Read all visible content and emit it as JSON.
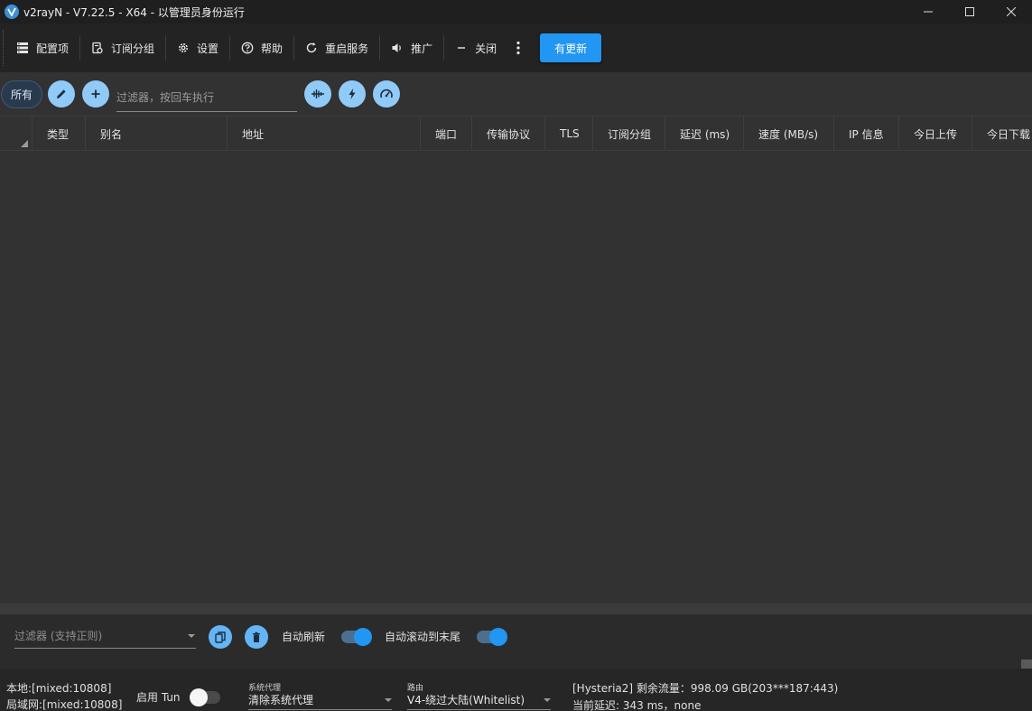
{
  "window": {
    "title": "v2rayN - V7.22.5 - X64 - 以管理员身份运行"
  },
  "toolbar": {
    "items": [
      {
        "label": "配置项",
        "icon": "server-icon"
      },
      {
        "label": "订阅分组",
        "icon": "subscription-icon"
      },
      {
        "label": "设置",
        "icon": "gear-icon"
      },
      {
        "label": "帮助",
        "icon": "help-icon"
      },
      {
        "label": "重启服务",
        "icon": "restart-icon"
      },
      {
        "label": "推广",
        "icon": "speaker-icon"
      },
      {
        "label": "关闭",
        "icon": "minus-icon"
      }
    ],
    "update_label": "有更新"
  },
  "filter": {
    "all_label": "所有",
    "placeholder": "过滤器，按回车执行"
  },
  "table": {
    "columns": [
      "类型",
      "别名",
      "地址",
      "端口",
      "传输协议",
      "TLS",
      "订阅分组",
      "延迟 (ms)",
      "速度 (MB/s)",
      "IP 信息",
      "今日上传",
      "今日下载"
    ]
  },
  "log": {
    "filter_placeholder": "过滤器 (支持正则)",
    "auto_refresh_label": "自动刷新",
    "auto_refresh_on": true,
    "auto_scroll_label": "自动滚动到末尾",
    "auto_scroll_on": true
  },
  "status": {
    "local": "本地:[mixed:10808]",
    "lan": "局域网:[mixed:10808]",
    "tun_label": "启用 Tun",
    "tun_on": false,
    "sys_proxy_caption": "系统代理",
    "sys_proxy_value": "清除系统代理",
    "routing_caption": "路由",
    "routing_value": "V4-绕过大陆(Whitelist)",
    "server_info": "[Hysteria2] 剩余流量：998.09 GB(203***187:443)",
    "delay_info": "当前延迟: 343 ms，none"
  },
  "colors": {
    "accent": "#2196f3",
    "round_button": "#90caf9",
    "background": "#323232"
  }
}
